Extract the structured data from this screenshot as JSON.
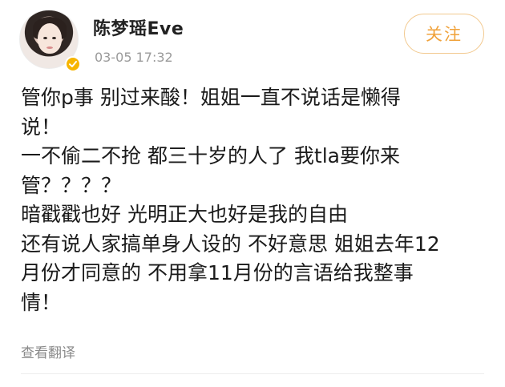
{
  "post": {
    "author": "陈梦瑶Eve",
    "time": "03-05 17:32",
    "follow_label": "关注",
    "lines": [
      "管你p事 别过来酸！姐姐一直不说话是懒得",
      "说！",
      "一不偷二不抢 都三十岁的人了 我tla要你来",
      "管？？？？",
      "暗戳戳也好 光明正大也好是我的自由",
      "还有说人家搞单身人设的 不好意思 姐姐去年12",
      "月份才同意的 不用拿11月份的言语给我整事",
      "情！"
    ],
    "translate_label": "查看翻译"
  },
  "colors": {
    "follow_accent": "#f0a23a",
    "verified_badge": "#f7b500",
    "meta_text": "#9a9a9a"
  },
  "icons": {
    "verified": "verified-badge-icon",
    "avatar": "avatar-image"
  }
}
